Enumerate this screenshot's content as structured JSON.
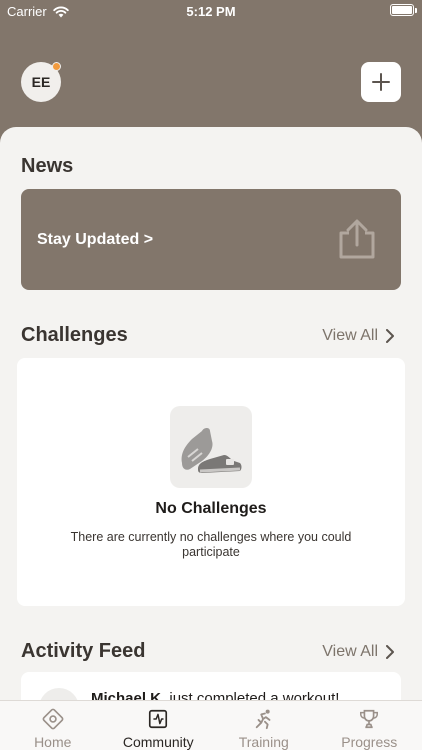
{
  "status_bar": {
    "carrier": "Carrier",
    "time": "5:12 PM"
  },
  "header": {
    "avatar_initials": "EE"
  },
  "news": {
    "title": "News",
    "card_label": "Stay Updated >"
  },
  "challenges": {
    "title": "Challenges",
    "view_all": "View All",
    "empty_title": "No Challenges",
    "empty_description": "There are currently no challenges where you could participate"
  },
  "activity_feed": {
    "title": "Activity Feed",
    "view_all": "View All",
    "first_item_user": "Michael K.",
    "first_item_text": " just completed a workout!"
  },
  "tabs": [
    {
      "label": "Home",
      "icon": "home-icon",
      "active": false
    },
    {
      "label": "Community",
      "icon": "community-icon",
      "active": true
    },
    {
      "label": "Training",
      "icon": "training-icon",
      "active": false
    },
    {
      "label": "Progress",
      "icon": "progress-icon",
      "active": false
    }
  ],
  "colors": {
    "accent": "#82766b",
    "notification": "#f19a3e",
    "sheet": "#f4f3f1"
  }
}
